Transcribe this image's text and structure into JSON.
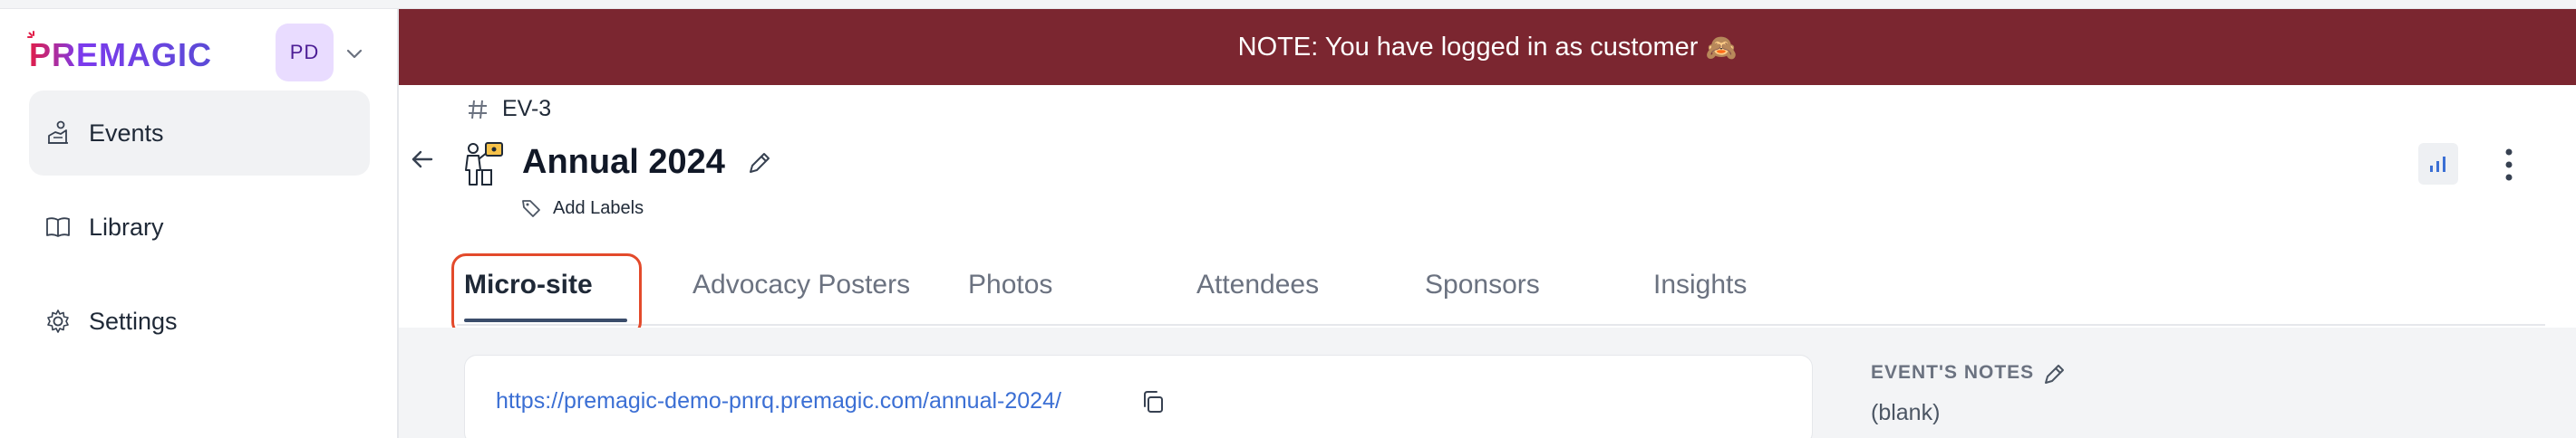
{
  "brand": {
    "name": "PREMAGIC"
  },
  "user": {
    "initials": "PD"
  },
  "sidebar": {
    "items": [
      {
        "label": "Events",
        "icon": "events-icon",
        "active": true
      },
      {
        "label": "Library",
        "icon": "book-icon",
        "active": false
      },
      {
        "label": "Settings",
        "icon": "gear-icon",
        "active": false
      }
    ]
  },
  "banner": {
    "text": "NOTE: You have logged in as customer",
    "emoji": "🙈"
  },
  "event": {
    "code": "EV-3",
    "title": "Annual 2024",
    "add_labels": "Add Labels"
  },
  "tabs": [
    {
      "label": "Micro-site",
      "active": true
    },
    {
      "label": "Advocacy Posters",
      "active": false
    },
    {
      "label": "Photos",
      "active": false
    },
    {
      "label": "Attendees",
      "active": false
    },
    {
      "label": "Sponsors",
      "active": false
    },
    {
      "label": "Insights",
      "active": false
    }
  ],
  "microsite": {
    "url": "https://premagic-demo-pnrq.premagic.com/annual-2024/"
  },
  "notes": {
    "label": "EVENT'S NOTES",
    "value": "(blank)"
  },
  "colors": {
    "banner": "#7b2630",
    "accent": "#7c3aed",
    "link": "#3b6fd4",
    "highlight": "#e34a2b"
  }
}
